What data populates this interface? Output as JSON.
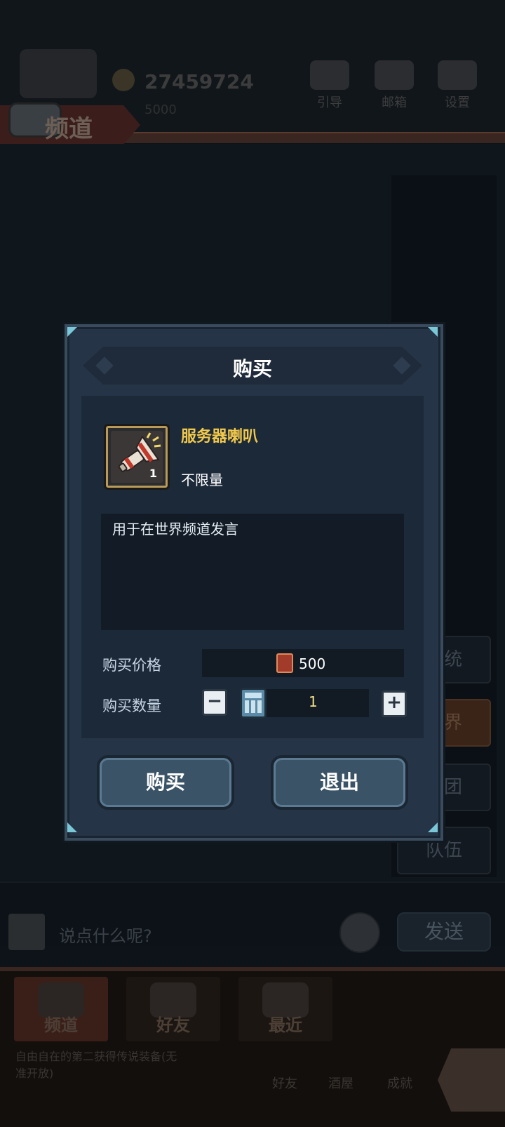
{
  "background": {
    "header": {
      "channel_tab": "频道",
      "coins": "27459724",
      "coins_sub": "5000",
      "buttons": [
        "引导",
        "邮箱",
        "设置"
      ]
    },
    "side_channels": [
      "系统",
      "世界",
      "军团",
      "队伍"
    ],
    "input": {
      "placeholder": "说点什么呢?",
      "send": "发送"
    },
    "bottom_tabs": [
      "频道",
      "好友",
      "最近"
    ],
    "news_line1": "自由自在的第二获得传说装备(无",
    "news_line2": "准开放)",
    "bottom_small": [
      "好友",
      "酒屋",
      "成就"
    ]
  },
  "dialog": {
    "title": "购买",
    "item": {
      "name": "服务器喇叭",
      "count": "1",
      "limit": "不限量",
      "icon": "megaphone-icon",
      "description": "用于在世界频道发言"
    },
    "price_label": "购买价格",
    "price_value": "500",
    "price_icon": "ticket-icon",
    "quantity_label": "购买数量",
    "quantity_value": "1",
    "buy_button": "购买",
    "exit_button": "退出"
  },
  "colors": {
    "item_name": "#f2c94c",
    "dialog_bg": "#263447",
    "button_bg": "#3a5366"
  }
}
